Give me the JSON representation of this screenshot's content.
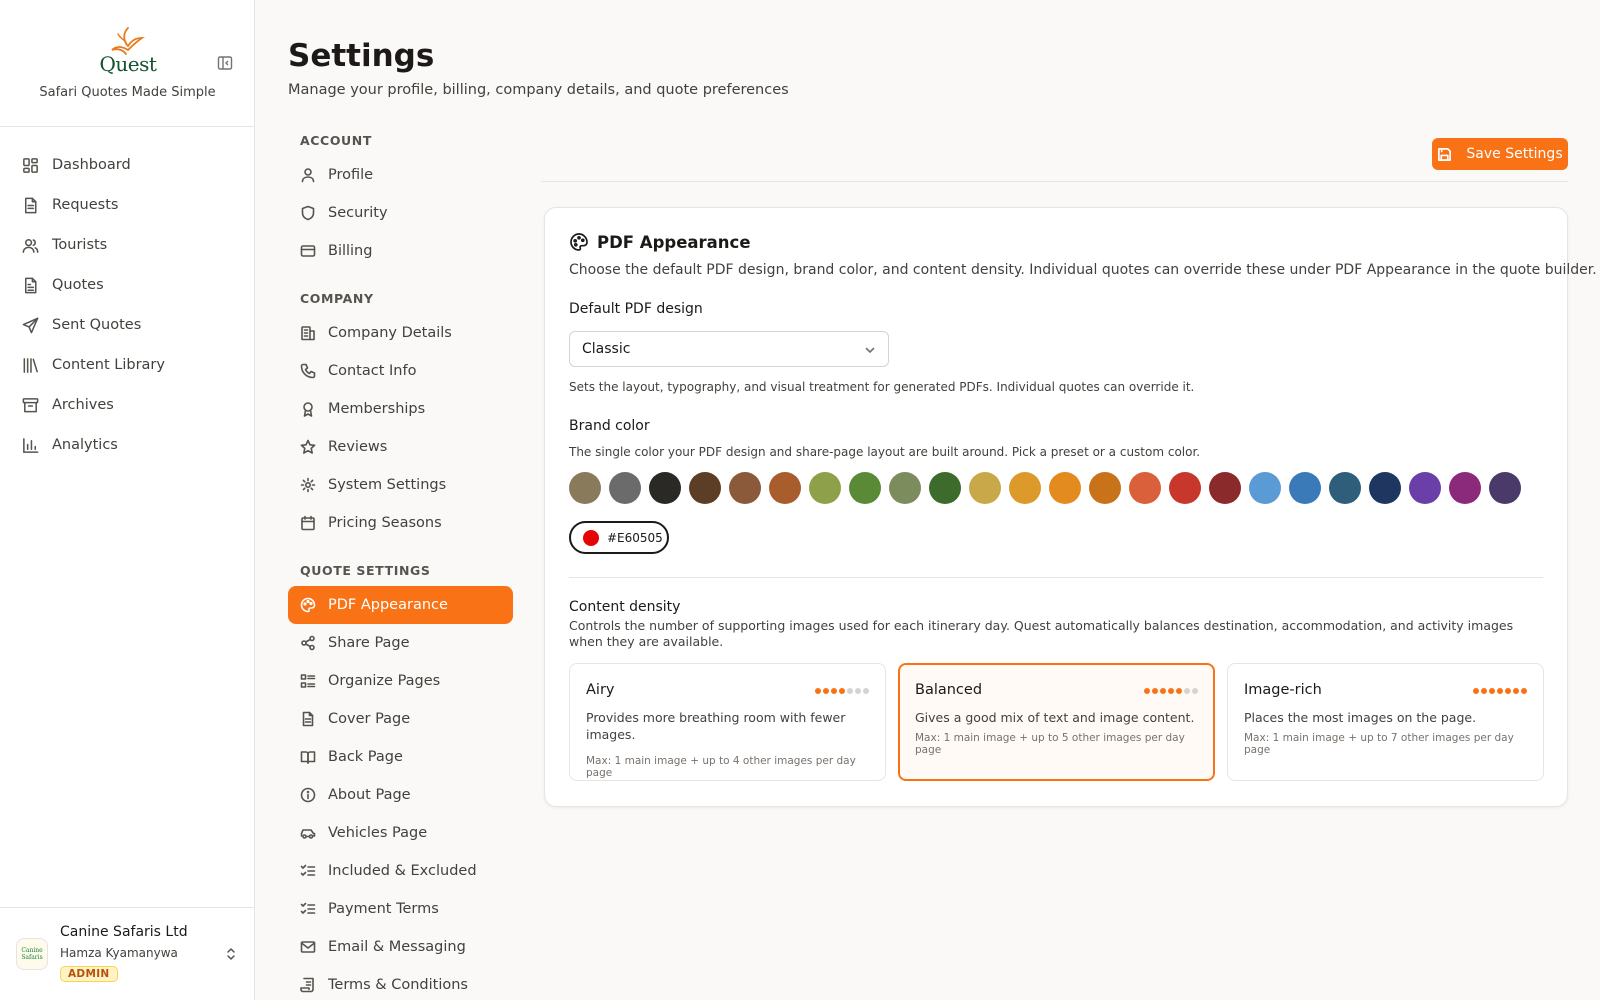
{
  "brand": {
    "logo_text": "Quest",
    "tagline": "Safari Quotes Made Simple"
  },
  "sidebar": {
    "items": [
      {
        "label": "Dashboard",
        "icon": "dashboard-icon"
      },
      {
        "label": "Requests",
        "icon": "document-icon"
      },
      {
        "label": "Tourists",
        "icon": "users-icon"
      },
      {
        "label": "Quotes",
        "icon": "file-text-icon"
      },
      {
        "label": "Sent Quotes",
        "icon": "send-icon"
      },
      {
        "label": "Content Library",
        "icon": "library-icon"
      },
      {
        "label": "Archives",
        "icon": "archive-icon"
      },
      {
        "label": "Analytics",
        "icon": "bar-chart-icon"
      }
    ]
  },
  "account": {
    "company": "Canine Safaris Ltd",
    "user": "Hamza Kyamanywa",
    "role": "ADMIN",
    "avatar_text": "Canine Safaris"
  },
  "header": {
    "title": "Settings",
    "subtitle": "Manage your profile, billing, company details, and quote preferences"
  },
  "settings_nav": {
    "account_heading": "ACCOUNT",
    "account": [
      "Profile",
      "Security",
      "Billing"
    ],
    "company_heading": "COMPANY",
    "company": [
      "Company Details",
      "Contact Info",
      "Memberships",
      "Reviews",
      "System Settings",
      "Pricing Seasons"
    ],
    "quote_heading": "QUOTE SETTINGS",
    "quote": [
      "PDF Appearance",
      "Share Page",
      "Organize Pages",
      "Cover Page",
      "Back Page",
      "About Page",
      "Vehicles Page",
      "Included & Excluded",
      "Payment Terms",
      "Email & Messaging",
      "Terms & Conditions"
    ],
    "active": "PDF Appearance"
  },
  "toolbar": {
    "save_label": "Save Settings"
  },
  "pdf": {
    "title": "PDF Appearance",
    "description": "Choose the default PDF design, brand color, and content density. Individual quotes can override these under PDF Appearance in the quote builder.",
    "design_label": "Default PDF design",
    "design_value": "Classic",
    "design_help": "Sets the layout, typography, and visual treatment for generated PDFs. Individual quotes can override it.",
    "brand_label": "Brand color",
    "brand_help": "The single color your PDF design and share-page layout are built around. Pick a preset or a custom color.",
    "swatches": [
      "#8a7a5c",
      "#6b6b6b",
      "#2b2926",
      "#5c3d26",
      "#8a5a3a",
      "#a85d2d",
      "#8fa04a",
      "#5a8a36",
      "#7d8c5c",
      "#3d6b2b",
      "#c9a84a",
      "#dc9a2a",
      "#e38b1e",
      "#c8731a",
      "#d9603a",
      "#c8372b",
      "#8b2a2a",
      "#5b9bd5",
      "#3a7ab8",
      "#2e5e7a",
      "#1f3660",
      "#6b3fa8",
      "#8b2a7a",
      "#4a3a6a"
    ],
    "custom_color": "#E60505",
    "density_label": "Content density",
    "density_desc": "Controls the number of supporting images used for each itinerary day. Quest automatically balances destination, accommodation, and activity images when they are available.",
    "density_options": [
      {
        "name": "Airy",
        "desc": "Provides more breathing room with fewer images.",
        "max": "Max: 1 main image + up to 4 other images per day page",
        "level": 4,
        "of": 7
      },
      {
        "name": "Balanced",
        "desc": "Gives a good mix of text and image content.",
        "max": "Max: 1 main image + up to 5 other images per day page",
        "level": 5,
        "of": 7
      },
      {
        "name": "Image-rich",
        "desc": "Places the most images on the page.",
        "max": "Max: 1 main image + up to 7 other images per day page",
        "level": 7,
        "of": 7
      }
    ],
    "density_selected": "Balanced"
  },
  "colors": {
    "accent": "#f97316",
    "active_dot": "#f97316",
    "inactive_dot": "#d6d3d1"
  }
}
